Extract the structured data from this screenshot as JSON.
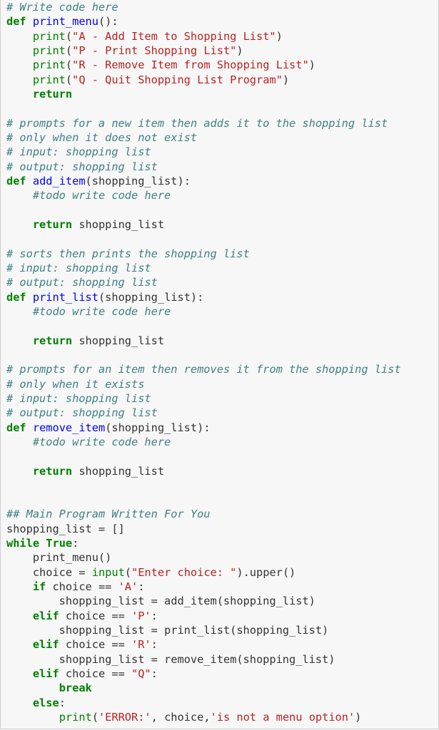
{
  "cell": {
    "language": "python",
    "lines": [
      [
        [
          "cm",
          "# Write code here"
        ]
      ],
      [
        [
          "kw",
          "def"
        ],
        [
          "tx",
          " "
        ],
        [
          "fn",
          "print_menu"
        ],
        [
          "tx",
          "():"
        ]
      ],
      [
        [
          "tx",
          "    "
        ],
        [
          "bi",
          "print"
        ],
        [
          "tx",
          "("
        ],
        [
          "str",
          "\"A - Add Item to Shopping List\""
        ],
        [
          "tx",
          ")"
        ]
      ],
      [
        [
          "tx",
          "    "
        ],
        [
          "bi",
          "print"
        ],
        [
          "tx",
          "("
        ],
        [
          "str",
          "\"P - Print Shopping List\""
        ],
        [
          "tx",
          ")"
        ]
      ],
      [
        [
          "tx",
          "    "
        ],
        [
          "bi",
          "print"
        ],
        [
          "tx",
          "("
        ],
        [
          "str",
          "\"R - Remove Item from Shopping List\""
        ],
        [
          "tx",
          ")"
        ]
      ],
      [
        [
          "tx",
          "    "
        ],
        [
          "bi",
          "print"
        ],
        [
          "tx",
          "("
        ],
        [
          "str",
          "\"Q - Quit Shopping List Program\""
        ],
        [
          "tx",
          ")"
        ]
      ],
      [
        [
          "tx",
          "    "
        ],
        [
          "kw",
          "return"
        ]
      ],
      [],
      [
        [
          "cm",
          "# prompts for a new item then adds it to the shopping list"
        ]
      ],
      [
        [
          "cm",
          "# only when it does not exist"
        ]
      ],
      [
        [
          "cm",
          "# input: shopping list"
        ]
      ],
      [
        [
          "cm",
          "# output: shopping list"
        ]
      ],
      [
        [
          "kw",
          "def"
        ],
        [
          "tx",
          " "
        ],
        [
          "fn",
          "add_item"
        ],
        [
          "tx",
          "(shopping_list):"
        ]
      ],
      [
        [
          "tx",
          "    "
        ],
        [
          "cm",
          "#todo write code here"
        ]
      ],
      [],
      [
        [
          "tx",
          "    "
        ],
        [
          "kw",
          "return"
        ],
        [
          "tx",
          " shopping_list"
        ]
      ],
      [],
      [
        [
          "cm",
          "# sorts then prints the shopping list"
        ]
      ],
      [
        [
          "cm",
          "# input: shopping list"
        ]
      ],
      [
        [
          "cm",
          "# output: shopping list"
        ]
      ],
      [
        [
          "kw",
          "def"
        ],
        [
          "tx",
          " "
        ],
        [
          "fn",
          "print_list"
        ],
        [
          "tx",
          "(shopping_list):"
        ]
      ],
      [
        [
          "tx",
          "    "
        ],
        [
          "cm",
          "#todo write code here"
        ]
      ],
      [],
      [
        [
          "tx",
          "    "
        ],
        [
          "kw",
          "return"
        ],
        [
          "tx",
          " shopping_list"
        ]
      ],
      [],
      [
        [
          "cm",
          "# prompts for an item then removes it from the shopping list"
        ]
      ],
      [
        [
          "cm",
          "# only when it exists"
        ]
      ],
      [
        [
          "cm",
          "# input: shopping list"
        ]
      ],
      [
        [
          "cm",
          "# output: shopping list"
        ]
      ],
      [
        [
          "kw",
          "def"
        ],
        [
          "tx",
          " "
        ],
        [
          "fn",
          "remove_item"
        ],
        [
          "tx",
          "(shopping_list):"
        ]
      ],
      [
        [
          "tx",
          "    "
        ],
        [
          "cm",
          "#todo write code here"
        ]
      ],
      [],
      [
        [
          "tx",
          "    "
        ],
        [
          "kw",
          "return"
        ],
        [
          "tx",
          " shopping_list"
        ]
      ],
      [],
      [],
      [
        [
          "cm",
          "## Main Program Written For You"
        ]
      ],
      [
        [
          "tx",
          "shopping_list = []"
        ]
      ],
      [
        [
          "kw",
          "while"
        ],
        [
          "tx",
          " "
        ],
        [
          "kw",
          "True"
        ],
        [
          "tx",
          ":"
        ]
      ],
      [
        [
          "tx",
          "    print_menu()"
        ]
      ],
      [
        [
          "tx",
          "    choice = "
        ],
        [
          "bi",
          "input"
        ],
        [
          "tx",
          "("
        ],
        [
          "str",
          "\"Enter choice: \""
        ],
        [
          "tx",
          ").upper()"
        ]
      ],
      [
        [
          "tx",
          "    "
        ],
        [
          "kw",
          "if"
        ],
        [
          "tx",
          " choice == "
        ],
        [
          "str",
          "'A'"
        ],
        [
          "tx",
          ":"
        ]
      ],
      [
        [
          "tx",
          "        shopping_list = add_item(shopping_list)"
        ]
      ],
      [
        [
          "tx",
          "    "
        ],
        [
          "kw",
          "elif"
        ],
        [
          "tx",
          " choice == "
        ],
        [
          "str",
          "'P'"
        ],
        [
          "tx",
          ":"
        ]
      ],
      [
        [
          "tx",
          "        shopping_list = print_list(shopping_list)"
        ]
      ],
      [
        [
          "tx",
          "    "
        ],
        [
          "kw",
          "elif"
        ],
        [
          "tx",
          " choice == "
        ],
        [
          "str",
          "'R'"
        ],
        [
          "tx",
          ":"
        ]
      ],
      [
        [
          "tx",
          "        shopping_list = remove_item(shopping_list)"
        ]
      ],
      [
        [
          "tx",
          "    "
        ],
        [
          "kw",
          "elif"
        ],
        [
          "tx",
          " choice == "
        ],
        [
          "str",
          "\"Q\""
        ],
        [
          "tx",
          ":"
        ]
      ],
      [
        [
          "tx",
          "        "
        ],
        [
          "kw",
          "break"
        ]
      ],
      [
        [
          "tx",
          "    "
        ],
        [
          "kw",
          "else"
        ],
        [
          "tx",
          ":"
        ]
      ],
      [
        [
          "tx",
          "        "
        ],
        [
          "bi",
          "print"
        ],
        [
          "tx",
          "("
        ],
        [
          "str",
          "'ERROR:'"
        ],
        [
          "tx",
          ", choice,"
        ],
        [
          "str",
          "'is not a menu option'"
        ],
        [
          "tx",
          ")"
        ]
      ]
    ]
  },
  "colors": {
    "background": "#f7f7f7",
    "border": "#cfcfcf",
    "keyword": "#008000",
    "function_name": "#0000ff",
    "string": "#ba2121",
    "comment": "#408080",
    "text": "#333333"
  }
}
